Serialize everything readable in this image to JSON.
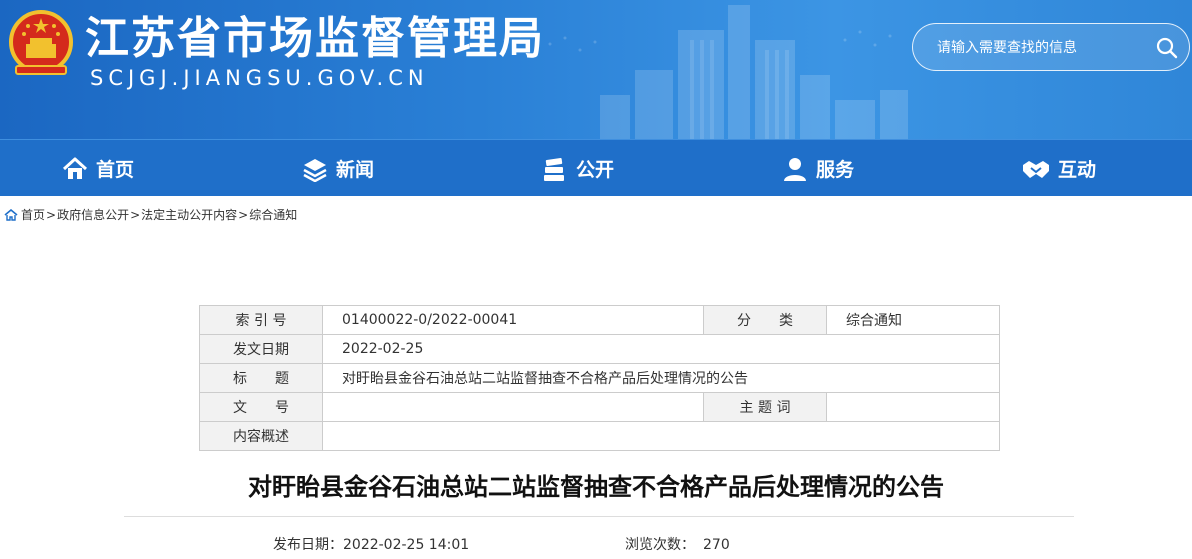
{
  "header": {
    "title": "江苏省市场监督管理局",
    "domain": "SCJGJ.JIANGSU.GOV.CN",
    "search_placeholder": "请输入需要查找的信息"
  },
  "nav": {
    "items": [
      {
        "label": "首页",
        "icon": "home-icon"
      },
      {
        "label": "新闻",
        "icon": "layers-icon"
      },
      {
        "label": "公开",
        "icon": "books-icon"
      },
      {
        "label": "服务",
        "icon": "user-icon"
      },
      {
        "label": "互动",
        "icon": "handshake-icon"
      }
    ]
  },
  "breadcrumb": {
    "icon": "home-small-icon",
    "items": [
      "首页",
      "政府信息公开",
      "法定主动公开内容",
      "综合通知"
    ],
    "separator": ">"
  },
  "info": {
    "index_label": "索 引 号",
    "index_value": "01400022-0/2022-00041",
    "category_label": "分　　类",
    "category_value": "综合通知",
    "date_label": "发文日期",
    "date_value": "2022-02-25",
    "title_label": "标　　题",
    "title_value": "对盱眙县金谷石油总站二站监督抽查不合格产品后处理情况的公告",
    "docno_label": "文　　号",
    "docno_value": "",
    "keywords_label": "主 题 词",
    "keywords_value": "",
    "summary_label": "内容概述",
    "summary_value": ""
  },
  "article": {
    "title": "对盱眙县金谷石油总站二站监督抽查不合格产品后处理情况的公告",
    "publish_label": "发布日期：",
    "publish_value": "2022-02-25 14:01",
    "views_label": "浏览次数：",
    "views_value": "270"
  },
  "colors": {
    "header_blue": "#2a80d6",
    "nav_blue": "#1f6fc9",
    "label_bg": "#f2f2f2",
    "border": "#cccccc"
  }
}
